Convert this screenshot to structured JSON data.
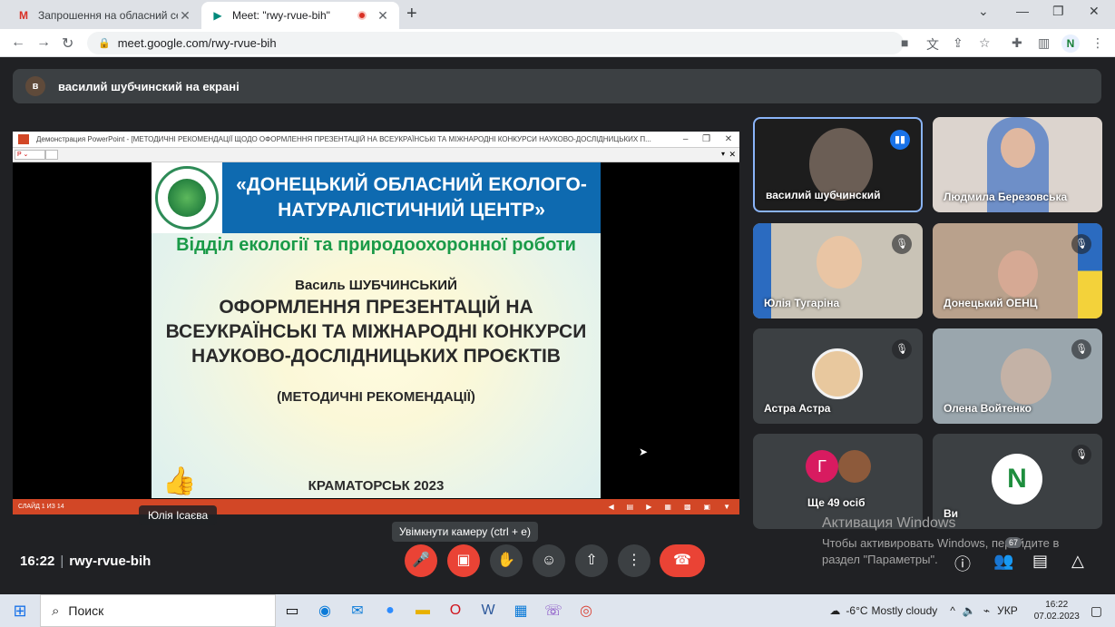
{
  "browser": {
    "tabs": [
      {
        "title": "Запрошення на обласний семі...",
        "icon": "gmail-icon",
        "icon_glyph": "M"
      },
      {
        "title": "Meet: \"rwy-rvue-bih\"",
        "icon": "meet-icon",
        "icon_glyph": "▶"
      }
    ],
    "url": "meet.google.com/rwy-rvue-bih",
    "profile_initial": "N"
  },
  "meet": {
    "presenter_banner": "василий шубчинский на екрані",
    "presenter_initial": "в",
    "shared": {
      "window_title": "Демонстрация PowerPoint - [МЕТОДИЧНІ РЕКОМЕНДАЦІЇ ЩОДО ОФОРМЛЕННЯ ПРЕЗЕНТАЦІЙ НА ВСЕУКРАЇНСЬКІ ТА МІЖНАРОДНІ КОНКУРСИ НАУКОВО-ДОСЛІДНИЦЬКИХ П...",
      "slide_status": "СЛАЙД 1 ИЗ 14",
      "slide": {
        "header": "«ДОНЕЦЬКИЙ ОБЛАСНИЙ ЕКОЛОГО-НАТУРАЛІСТИЧНИЙ ЦЕНТР»",
        "department": "Відділ екології та природоохоронної роботи",
        "author": "Василь ШУБЧИНСЬКИЙ",
        "title": "ОФОРМЛЕННЯ ПРЕЗЕНТАЦІЙ НА ВСЕУКРАЇНСЬКІ ТА МІЖНАРОДНІ КОНКУРСИ НАУКОВО-ДОСЛІДНИЦЬКИХ ПРОЄКТІВ",
        "subtitle": "(МЕТОДИЧНІ РЕКОМЕНДАЦІЇ)",
        "city": "КРАМАТОРСЬК 2023"
      }
    },
    "self_name_chip": "Юлія Ісаєва",
    "participants": [
      {
        "name": "василий шубчинский",
        "speaking": true
      },
      {
        "name": "Людмила Березовська",
        "speaking": false
      },
      {
        "name": "Юлія Тугаріна",
        "speaking": false
      },
      {
        "name": "Донецький ОЕНЦ",
        "speaking": false
      },
      {
        "name": "Астра Астра",
        "speaking": false
      },
      {
        "name": "Олена Войтенко",
        "speaking": false
      },
      {
        "name": "Ще 49 осіб",
        "speaking": false,
        "initial": "Г"
      },
      {
        "name": "Ви",
        "speaking": false,
        "initial": "N"
      }
    ],
    "tooltip": "Увімкнути камеру (ctrl + e)",
    "time": "16:22",
    "meeting_code": "rwy-rvue-bih",
    "people_count": "67",
    "windows_activation": {
      "title": "Активация Windows",
      "text": "Чтобы активировать Windows, перейдите в раздел \"Параметры\"."
    }
  },
  "taskbar": {
    "search_placeholder": "Поиск",
    "weather_temp": "-6°C",
    "weather_text": "Mostly cloudy",
    "lang": "УКР",
    "time": "16:22",
    "date": "07.02.2023"
  },
  "colors": {
    "meet_bg": "#202124",
    "end_call": "#ea4335",
    "slide_header": "#0e6ab0",
    "ppt_accent": "#d24726"
  }
}
